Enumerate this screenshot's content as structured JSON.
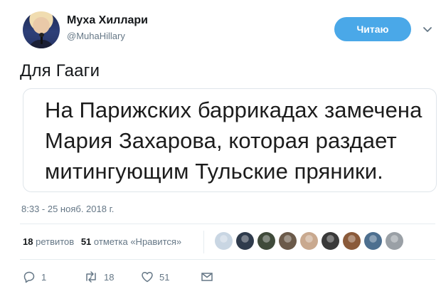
{
  "author": {
    "name": "Муха Хиллари",
    "handle": "@MuhaHillary"
  },
  "follow_button": {
    "label": "Читаю",
    "color": "#4aa8e8"
  },
  "tweet": {
    "text": "Для Гааги",
    "quote_lines": [
      "На Парижских баррикадах замечена",
      "Мария Захарова, которая раздает",
      "митингующим Тульские пряники."
    ],
    "timestamp": "8:33 - 25 нояб. 2018 г."
  },
  "stats": {
    "retweets_count": "18",
    "retweets_label": "ретвитов",
    "likes_count": "51",
    "likes_label": "отметка «Нравится»"
  },
  "likers": [
    {
      "icon": "avatar-1",
      "color": "#c9d6e3"
    },
    {
      "icon": "avatar-2",
      "color": "#2f3b4c"
    },
    {
      "icon": "avatar-3",
      "color": "#3f4a3a"
    },
    {
      "icon": "avatar-4",
      "color": "#6b5a4a"
    },
    {
      "icon": "avatar-5",
      "color": "#c9a98f"
    },
    {
      "icon": "avatar-6",
      "color": "#3a3a3a"
    },
    {
      "icon": "avatar-7",
      "color": "#8a5a3a"
    },
    {
      "icon": "avatar-8",
      "color": "#4d6f8f"
    },
    {
      "icon": "avatar-9",
      "color": "#9aa0a6"
    }
  ],
  "actions": {
    "replies": "1",
    "retweets": "18",
    "likes": "51"
  }
}
